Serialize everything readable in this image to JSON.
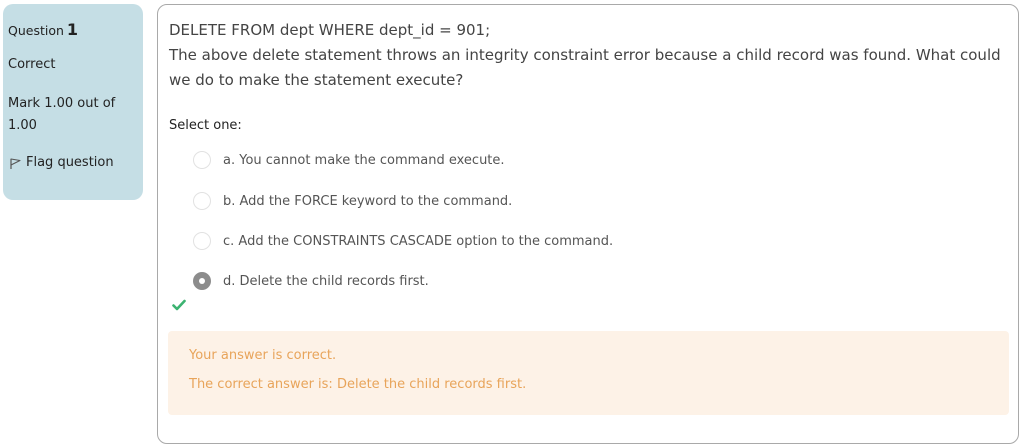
{
  "info": {
    "question_label": "Question",
    "question_number": "1",
    "state": "Correct",
    "grade": "Mark 1.00 out of 1.00",
    "flag_label": "Flag question"
  },
  "question": {
    "sql": "DELETE FROM dept WHERE dept_id = 901;",
    "text": "The above delete statement throws an integrity constraint error because a child record was found. What could we do to make the statement execute?",
    "prompt": "Select one:",
    "options": [
      {
        "label": "a. You cannot make the command execute.",
        "selected": false
      },
      {
        "label": "b. Add the FORCE keyword to the command.",
        "selected": false
      },
      {
        "label": "c. Add the CONSTRAINTS CASCADE option to the command.",
        "selected": false
      },
      {
        "label": "d. Delete the child records first.",
        "selected": true
      }
    ]
  },
  "feedback": {
    "result": "Your answer is correct.",
    "right_answer": "The correct answer is: Delete the child records first."
  },
  "colors": {
    "info_bg": "#c5dee5",
    "feedback_bg": "#fdf2e7",
    "feedback_text": "#e8a45a",
    "check": "#3cb371"
  },
  "icons": {
    "flag": "flag-icon",
    "correct": "check-icon"
  }
}
